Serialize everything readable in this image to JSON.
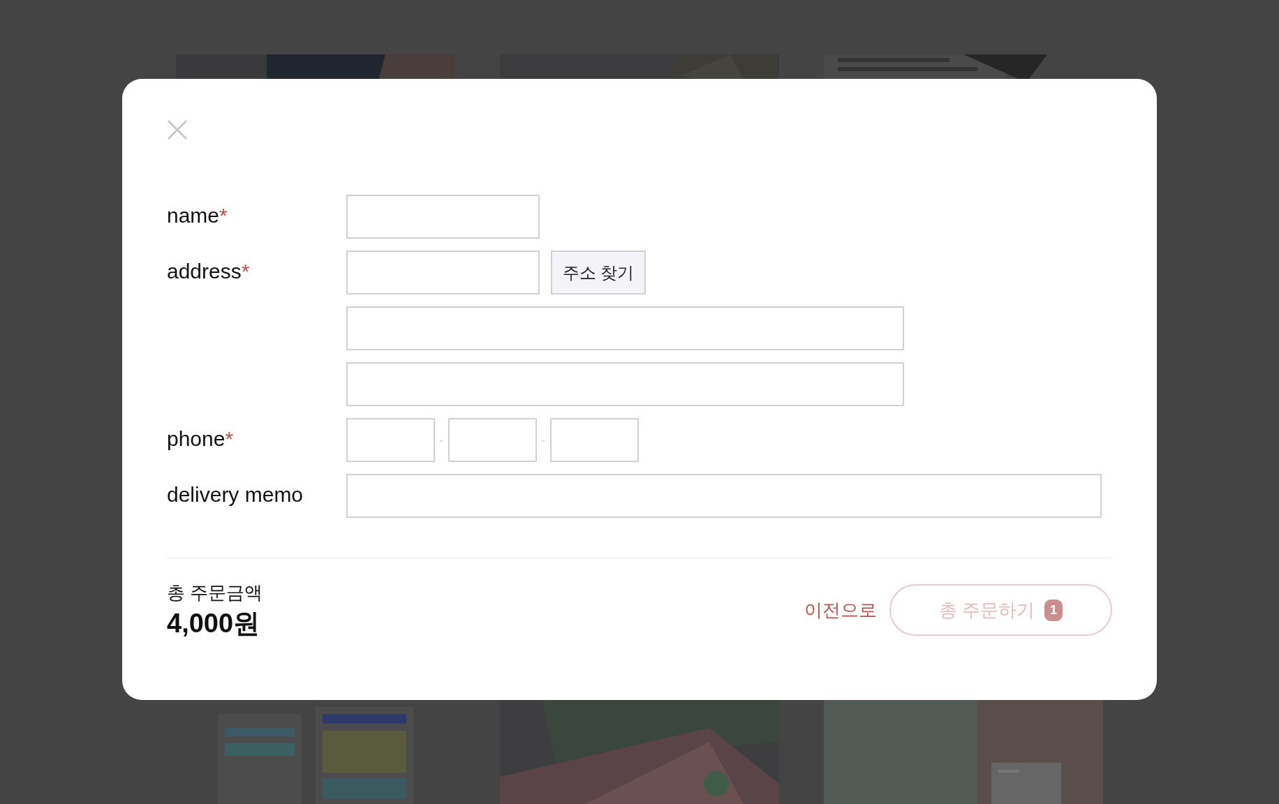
{
  "form": {
    "rows": [
      {
        "label": "name",
        "required_mark": "*",
        "kind": "single"
      },
      {
        "label": "address",
        "required_mark": "*",
        "kind": "address",
        "button": "주소 찾기"
      },
      {
        "label": "phone",
        "required_mark": "*",
        "kind": "phone",
        "separators": [
          "-",
          "-"
        ]
      },
      {
        "label": "delivery memo",
        "kind": "wide"
      }
    ]
  },
  "summary": {
    "label": "총 주문금액",
    "amount": "4,000원"
  },
  "actions": {
    "back": "이전으로",
    "order": {
      "label": "총 주문하기",
      "count": "1",
      "disabled": true
    }
  }
}
